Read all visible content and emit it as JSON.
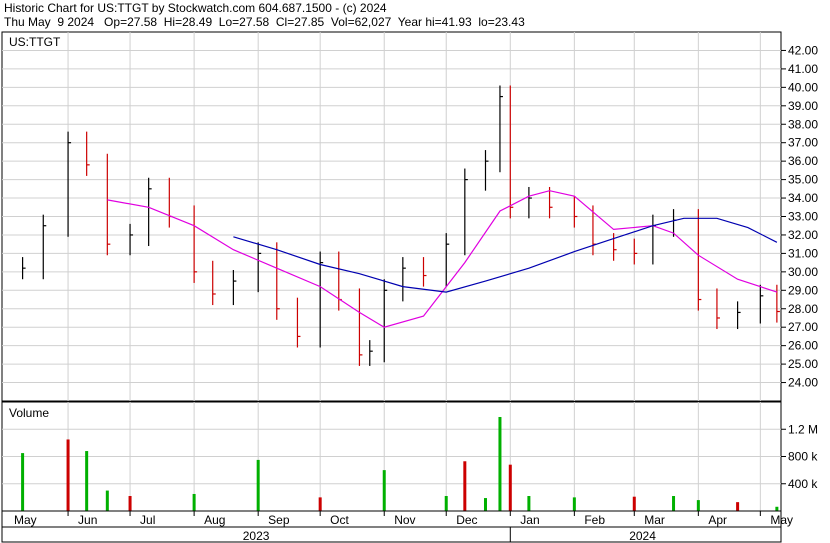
{
  "header": {
    "line1": "Historic Chart for US:TTGT by Stockwatch.com 604.687.1500 - (c) 2024",
    "line2": "Thu May  9 2024   Op=27.58  Hi=28.49  Lo=27.58  Cl=27.85  Vol=62,027  Year hi=41.93  lo=23.43"
  },
  "colors": {
    "up": "#000000",
    "down": "#cc0000",
    "ma_short": "#e000e0",
    "ma_long": "#0000b0",
    "vol_up": "#00b000",
    "vol_down": "#cc0000",
    "grid": "#d0d0d0"
  },
  "chart_data": [
    {
      "type": "line",
      "title": "US:TTGT",
      "ylim": [
        23,
        43
      ],
      "y_ticks": [
        "42.00",
        "41.00",
        "40.00",
        "39.00",
        "38.00",
        "37.00",
        "36.00",
        "35.00",
        "34.00",
        "33.00",
        "32.00",
        "31.00",
        "30.00",
        "29.00",
        "28.00",
        "27.00",
        "26.00",
        "25.00",
        "24.00"
      ],
      "x_ticks": [
        "May",
        "Jun",
        "Jul",
        "Aug",
        "Sep",
        "Oct",
        "Nov",
        "Dec",
        "Jan",
        "Feb",
        "Mar",
        "Apr",
        "May"
      ],
      "years": [
        "2023",
        "2024"
      ],
      "x": [
        "2023-05-10",
        "2023-05-20",
        "2023-06-01",
        "2023-06-10",
        "2023-06-20",
        "2023-07-01",
        "2023-07-10",
        "2023-07-20",
        "2023-08-01",
        "2023-08-10",
        "2023-08-20",
        "2023-09-01",
        "2023-09-10",
        "2023-09-20",
        "2023-10-01",
        "2023-10-10",
        "2023-10-20",
        "2023-10-25",
        "2023-11-01",
        "2023-11-10",
        "2023-11-20",
        "2023-12-01",
        "2023-12-10",
        "2023-12-20",
        "2023-12-27",
        "2024-01-01",
        "2024-01-10",
        "2024-01-20",
        "2024-02-01",
        "2024-02-10",
        "2024-02-20",
        "2024-03-01",
        "2024-03-10",
        "2024-03-20",
        "2024-04-01",
        "2024-04-10",
        "2024-04-20",
        "2024-05-01",
        "2024-05-09"
      ],
      "series": [
        {
          "values": [
            30.2,
            32.5,
            37.0,
            35.8,
            31.5,
            32.0,
            34.5,
            33.0,
            30.0,
            28.8,
            29.5,
            31.0,
            28.0,
            26.5,
            30.5,
            28.5,
            25.5,
            25.7,
            29.0,
            30.2,
            29.8,
            31.5,
            35.0,
            36.0,
            39.5,
            33.5,
            34.0,
            33.5,
            33.0,
            31.5,
            31.2,
            31.0,
            32.5,
            32.8,
            28.5,
            27.5,
            27.8,
            28.7,
            27.85
          ]
        },
        {
          "x": [
            "2023-06-20",
            "2023-07-10",
            "2023-08-01",
            "2023-08-20",
            "2023-09-10",
            "2023-10-01",
            "2023-10-20",
            "2023-11-01",
            "2023-11-20",
            "2023-12-10",
            "2023-12-27",
            "2024-01-10",
            "2024-01-20",
            "2024-02-01",
            "2024-02-20",
            "2024-03-10",
            "2024-03-20",
            "2024-04-01",
            "2024-04-20",
            "2024-05-09"
          ],
          "values": [
            33.9,
            33.5,
            32.5,
            31.2,
            30.2,
            29.2,
            27.8,
            27.0,
            27.6,
            30.5,
            33.3,
            34.1,
            34.4,
            34.1,
            32.3,
            32.5,
            32.1,
            30.9,
            29.6,
            28.9
          ]
        },
        {
          "x": [
            "2023-08-20",
            "2023-09-10",
            "2023-10-01",
            "2023-10-20",
            "2023-11-10",
            "2023-12-01",
            "2023-12-20",
            "2024-01-10",
            "2024-02-01",
            "2024-02-20",
            "2024-03-10",
            "2024-03-25",
            "2024-04-10",
            "2024-04-25",
            "2024-05-09"
          ],
          "values": [
            31.9,
            31.2,
            30.4,
            29.9,
            29.2,
            28.9,
            29.5,
            30.2,
            31.1,
            31.8,
            32.5,
            32.9,
            32.9,
            32.4,
            31.6
          ]
        }
      ]
    },
    {
      "type": "bar",
      "title": "Volume",
      "ylim": [
        0,
        1600000
      ],
      "y_ticks": [
        "1.2 M",
        "800 k",
        "400 k"
      ],
      "x": [
        "2023-05-10",
        "2023-06-01",
        "2023-06-10",
        "2023-06-20",
        "2023-07-01",
        "2023-08-01",
        "2023-09-01",
        "2023-10-01",
        "2023-11-01",
        "2023-12-01",
        "2023-12-10",
        "2023-12-20",
        "2023-12-27",
        "2024-01-01",
        "2024-01-10",
        "2024-02-01",
        "2024-03-01",
        "2024-03-20",
        "2024-04-01",
        "2024-04-20",
        "2024-05-09"
      ],
      "values": [
        850000,
        1050000,
        880000,
        300000,
        220000,
        250000,
        750000,
        200000,
        600000,
        220000,
        730000,
        190000,
        1380000,
        680000,
        220000,
        200000,
        210000,
        220000,
        160000,
        130000,
        62027
      ]
    }
  ]
}
